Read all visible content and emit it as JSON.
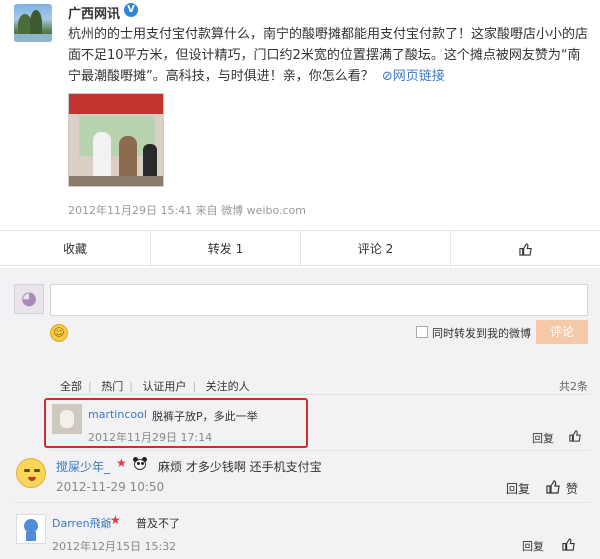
{
  "post": {
    "author": "广西网讯",
    "verified_mark": "V",
    "text": "杭州的的士用支付宝付款算什么，南宁的酸嘢摊都能用支付宝付款了！这家酸嘢店小小的店面不足10平方米，但设计精巧，门口约2米宽的位置摆满了酸坛。这个摊点被网友赞为“南宁最潮酸嘢摊”。高科技，与时俱进！亲，你怎么看？",
    "link_icon": "link-icon",
    "link_label": "网页链接",
    "meta": "2012年11月29日 15:41 来自 微博 weibo.com"
  },
  "actions": {
    "favorite": "收藏",
    "repost": "转发 1",
    "comment": "评论 2",
    "like_icon": "thumbs-up-icon"
  },
  "composer": {
    "emoji_icon": "smile-icon",
    "repost_checkbox_label": "同时转发到我的微博",
    "submit_label": "评论"
  },
  "filters": {
    "tabs": [
      "全部",
      "热门",
      "认证用户",
      "关注的人"
    ],
    "total": "共2条"
  },
  "comments": [
    {
      "user": "martincool",
      "text": "脱裤子放P，多此一举",
      "time": "2012年11月29日 17:14",
      "reply": "回复"
    },
    {
      "user": "搅屎少年_",
      "text": "麻烦 才多少钱啊 还手机支付宝",
      "time": "2012-11-29 10:50",
      "reply": "回复",
      "like": "赞"
    },
    {
      "user": "Darren飛爺",
      "text": "普及不了",
      "time": "2012年12月15日 15:32",
      "reply": "回复"
    }
  ],
  "colors": {
    "link": "#3a79c1",
    "highlight": "#d12d2d",
    "submit": "#f5c9a8"
  }
}
